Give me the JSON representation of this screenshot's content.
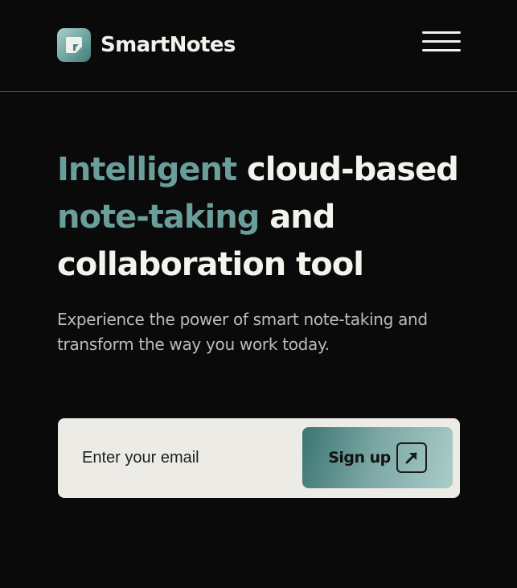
{
  "brand": {
    "name": "SmartNotes",
    "logo_icon": "note-logo-icon",
    "accent_color": "#6a9e9b"
  },
  "nav": {
    "menu_icon": "hamburger-menu-icon"
  },
  "hero": {
    "title_accent_1": "Intelligent",
    "title_part_1": " cloud-based",
    "title_accent_2": "note-taking",
    "title_part_2": " and",
    "title_part_3": "collaboration tool",
    "subtitle": "Experience the power of smart note-taking and transform the way you work today."
  },
  "signup": {
    "email_placeholder": "Enter your email",
    "button_label": "Sign up",
    "button_icon": "arrow-up-right-icon"
  }
}
